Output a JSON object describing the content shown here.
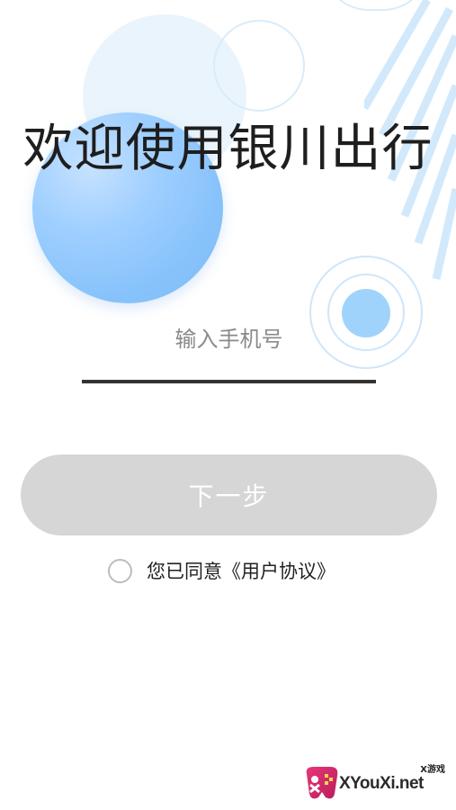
{
  "title": "欢迎使用银川出行",
  "phone": {
    "placeholder": "输入手机号",
    "value": ""
  },
  "next_button": {
    "label": "下一步",
    "enabled": false
  },
  "agreement": {
    "checked": false,
    "prefix": "您已同意",
    "link_label": "《用户协议》"
  },
  "watermark": {
    "small_text": "X游戏",
    "main_text": "XYouXi.net"
  },
  "colors": {
    "accent_blue": "#87c2fb",
    "button_disabled": "#d6d6d6",
    "title": "#1e1e1e"
  }
}
